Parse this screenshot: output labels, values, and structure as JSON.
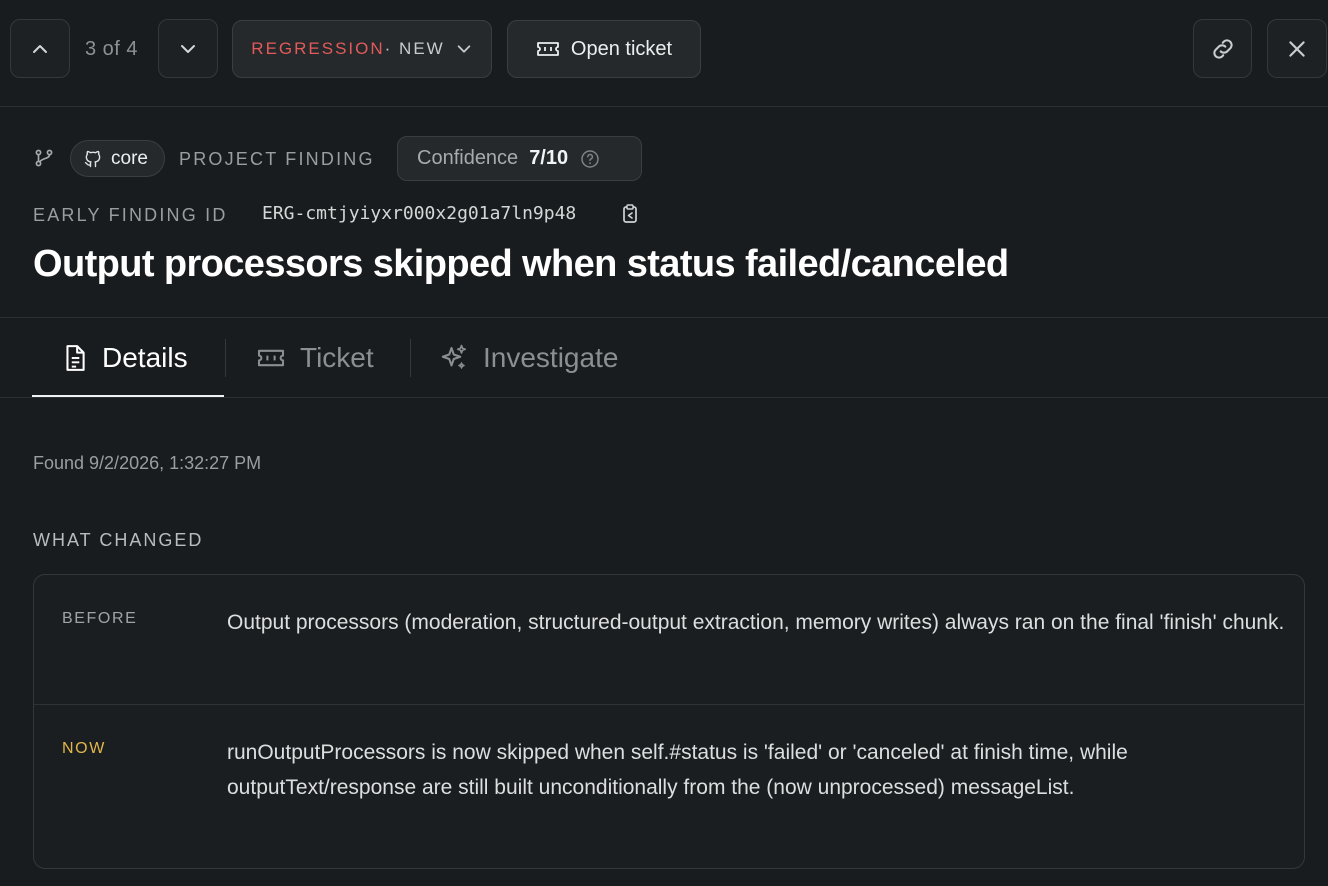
{
  "nav": {
    "counter": "3 of 4",
    "status_kind": "REGRESSION",
    "status_state": "· NEW",
    "open_ticket_label": "Open ticket",
    "prev_icon": "chevron-up-icon",
    "next_icon": "chevron-down-icon",
    "link_icon": "link-icon",
    "close_icon": "close-icon"
  },
  "meta": {
    "repo": "core",
    "scope": "PROJECT FINDING",
    "confidence_label": "Confidence",
    "confidence_value": "7/10",
    "early_id_label": "EARLY FINDING ID",
    "early_id": "ERG-cmtjyiyxr000x2g01a7ln9p48"
  },
  "title": "Output processors skipped when status failed/canceled",
  "tabs": [
    {
      "label": "Details",
      "icon": "document-icon",
      "active": true
    },
    {
      "label": "Ticket",
      "icon": "ticket-icon",
      "active": false
    },
    {
      "label": "Investigate",
      "icon": "sparkles-icon",
      "active": false
    }
  ],
  "details": {
    "found": "Found 9/2/2026, 1:32:27 PM",
    "what_changed_heading": "WHAT CHANGED",
    "before_label": "BEFORE",
    "before_text": "Output processors (moderation, structured-output extraction, memory writes) always ran on the final 'finish' chunk.",
    "now_label": "NOW",
    "now_text": "runOutputProcessors is now skipped when self.#status is 'failed' or 'canceled' at finish time, while outputText/response are still built unconditionally from the (now unprocessed) messageList."
  },
  "colors": {
    "background": "#191c1e",
    "regression": "#e35a5a",
    "now_label": "#e2b64b"
  }
}
